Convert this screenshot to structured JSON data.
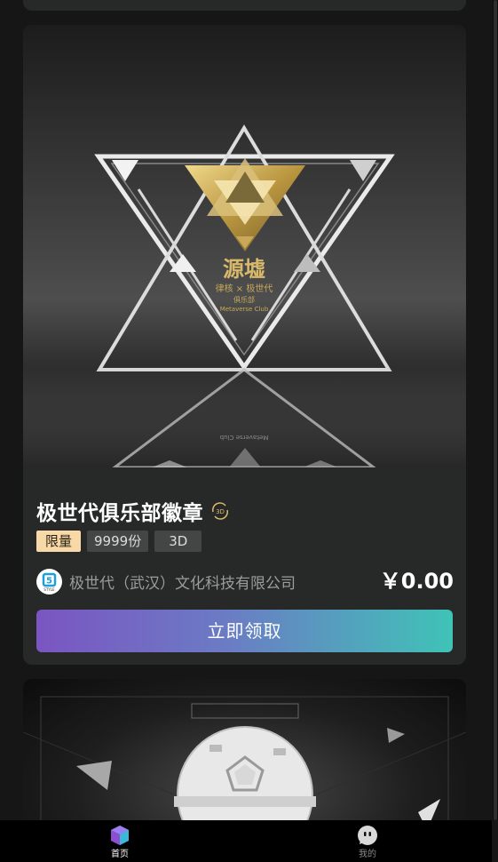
{
  "card": {
    "title": "极世代俱乐部徽章",
    "badge_3d": "3D",
    "tags": {
      "limited": "限量",
      "count": "9999份",
      "format": "3D"
    },
    "issuer": "极世代（武汉）文化科技有限公司",
    "price": "￥0.00",
    "claim_label": "立即领取",
    "image": {
      "text_main": "源墟",
      "text_sub": "律核 × 极世代",
      "text_sub2": "俱乐部",
      "text_en": "Metaverse Club"
    }
  },
  "tabbar": {
    "home_label": "首页",
    "mine_label": "我的"
  },
  "colors": {
    "background": "#161616",
    "card": "#272828",
    "tag_limited_bg": "#f7d8a6",
    "button_start": "#7b55c2",
    "button_end": "#3fc3b7"
  },
  "icons": {
    "home": "cube-icon",
    "mine": "robot-face-icon",
    "badge": "3d-rotate-icon"
  }
}
